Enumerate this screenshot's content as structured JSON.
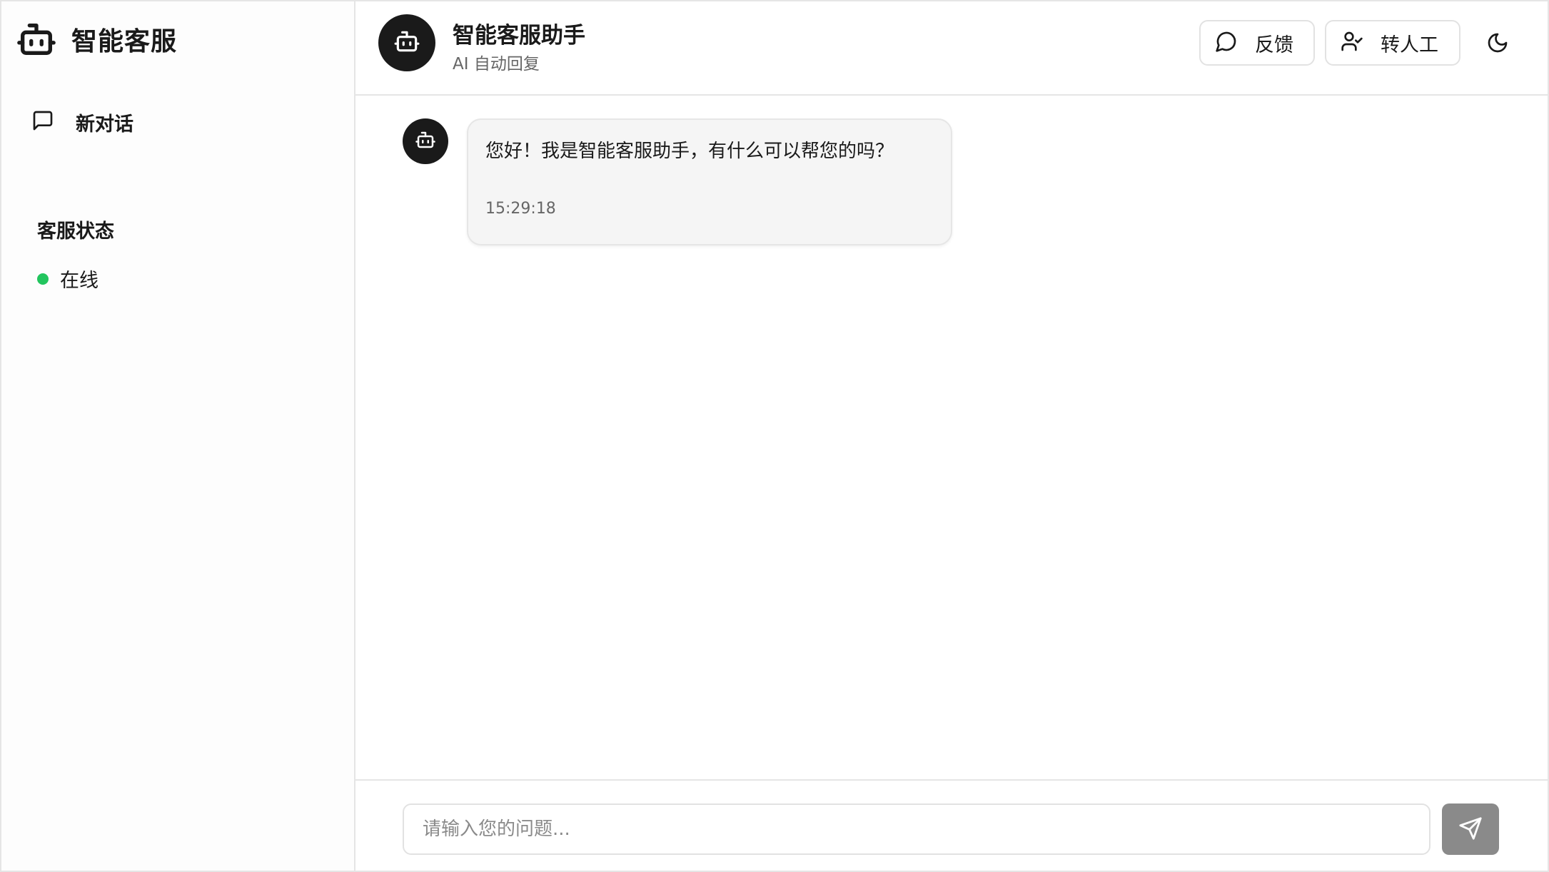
{
  "sidebar": {
    "brand_title": "智能客服",
    "brand_icon": "bot-icon",
    "new_chat_label": "新对话",
    "new_chat_icon": "message-square-icon",
    "status_heading": "客服状态",
    "status_text": "在线",
    "status_color": "#22c55e"
  },
  "header": {
    "title": "智能客服助手",
    "subtitle": "AI 自动回复",
    "feedback_label": "反馈",
    "feedback_icon": "message-circle-icon",
    "human_label": "转人工",
    "human_icon": "user-check-icon",
    "theme_icon": "moon-icon"
  },
  "messages": [
    {
      "sender": "bot",
      "text": "您好！我是智能客服助手，有什么可以帮您的吗？",
      "time": "15:29:18"
    }
  ],
  "input": {
    "placeholder": "请输入您的问题...",
    "value": "",
    "send_icon": "send-icon"
  },
  "colors": {
    "accent_dark": "#1a1a1a",
    "send_button": "#8a8a8a",
    "bubble_bg": "#f5f5f5"
  }
}
